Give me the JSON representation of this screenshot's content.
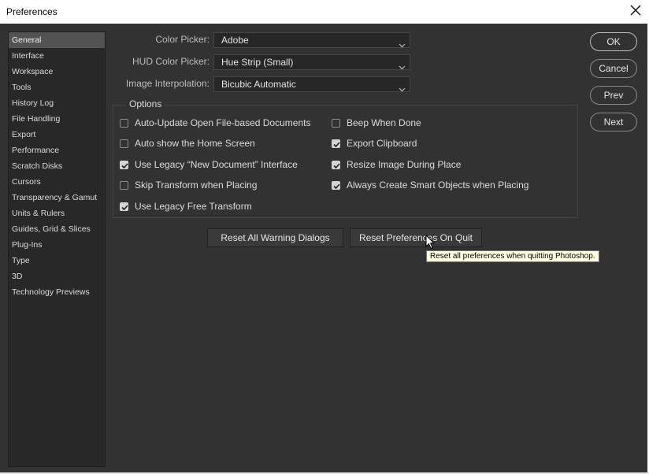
{
  "window": {
    "title": "Preferences"
  },
  "sidebar": {
    "items": [
      {
        "label": "General",
        "active": true
      },
      {
        "label": "Interface"
      },
      {
        "label": "Workspace"
      },
      {
        "label": "Tools"
      },
      {
        "label": "History Log"
      },
      {
        "label": "File Handling"
      },
      {
        "label": "Export"
      },
      {
        "label": "Performance"
      },
      {
        "label": "Scratch Disks"
      },
      {
        "label": "Cursors"
      },
      {
        "label": "Transparency & Gamut"
      },
      {
        "label": "Units & Rulers"
      },
      {
        "label": "Guides, Grid & Slices"
      },
      {
        "label": "Plug-Ins"
      },
      {
        "label": "Type"
      },
      {
        "label": "3D"
      },
      {
        "label": "Technology Previews"
      }
    ]
  },
  "fields": {
    "color_picker": {
      "label": "Color Picker:",
      "value": "Adobe"
    },
    "hud_color_picker": {
      "label": "HUD Color Picker:",
      "value": "Hue Strip (Small)"
    },
    "image_interpolation": {
      "label": "Image Interpolation:",
      "value": "Bicubic Automatic"
    }
  },
  "options": {
    "title": "Options",
    "left": [
      {
        "label": "Auto-Update Open File-based Documents",
        "checked": false
      },
      {
        "label": "Auto show the Home Screen",
        "checked": false
      },
      {
        "label": "Use Legacy “New Document” Interface",
        "checked": true
      },
      {
        "label": "Skip Transform when Placing",
        "checked": false
      },
      {
        "label": "Use Legacy Free Transform",
        "checked": true
      }
    ],
    "right": [
      {
        "label": "Beep When Done",
        "checked": false
      },
      {
        "label": "Export Clipboard",
        "checked": true
      },
      {
        "label": "Resize Image During Place",
        "checked": true
      },
      {
        "label": "Always Create Smart Objects when Placing",
        "checked": true
      }
    ]
  },
  "buttons": {
    "ok": "OK",
    "cancel": "Cancel",
    "prev": "Prev",
    "next": "Next",
    "reset_warnings": "Reset All Warning Dialogs",
    "reset_prefs": "Reset Preferences On Quit"
  },
  "tooltip": "Reset all preferences when quitting Photoshop.",
  "colors": {
    "panel_bg": "#323232",
    "sidebar_bg": "#282828",
    "selected_item": "#535353",
    "tooltip_bg": "#ffffe1"
  }
}
